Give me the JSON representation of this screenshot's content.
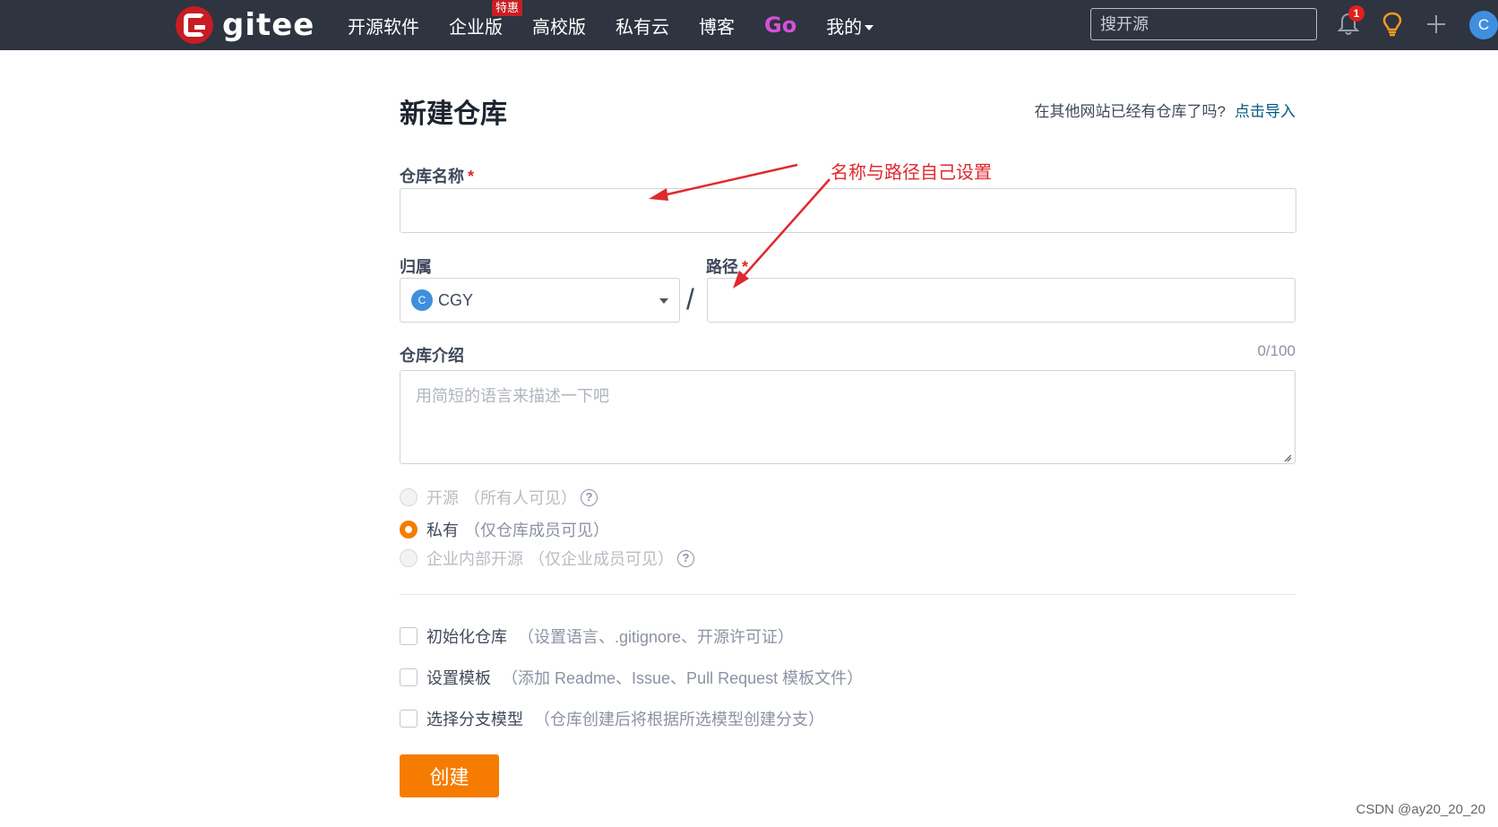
{
  "topbar": {
    "logo_text": "gitee",
    "nav": [
      {
        "label": "开源软件"
      },
      {
        "label": "企业版",
        "badge": "特惠"
      },
      {
        "label": "高校版"
      },
      {
        "label": "私有云"
      },
      {
        "label": "博客"
      },
      {
        "label": "Go"
      },
      {
        "label": "我的"
      }
    ],
    "search_placeholder": "搜开源",
    "notification_count": "1",
    "avatar_letter": "C",
    "icons": [
      "bell-icon",
      "lightbulb-icon",
      "plus-icon"
    ]
  },
  "form": {
    "title": "新建仓库",
    "import_text": "在其他网站已经有仓库了吗?",
    "import_link": "点击导入",
    "name_label": "仓库名称",
    "required_mark": "*",
    "owner_label": "归属",
    "owner_avatar_letter": "C",
    "owner_value": "CGY",
    "slash": "/",
    "path_label": "路径",
    "desc_label": "仓库介绍",
    "desc_counter": "0/100",
    "desc_placeholder": "用简短的语言来描述一下吧",
    "visibility": [
      {
        "main": "开源",
        "sub": "（所有人可见）",
        "selected": false,
        "disabled": true,
        "help": true
      },
      {
        "main": "私有",
        "sub": "（仅仓库成员可见）",
        "selected": true,
        "disabled": false,
        "help": false
      },
      {
        "main": "企业内部开源",
        "sub": "（仅企业成员可见）",
        "selected": false,
        "disabled": true,
        "help": true
      }
    ],
    "help_glyph": "?",
    "options": [
      {
        "main": "初始化仓库",
        "sub": "（设置语言、.gitignore、开源许可证）"
      },
      {
        "main": "设置模板",
        "sub": "（添加 Readme、Issue、Pull Request 模板文件）"
      },
      {
        "main": "选择分支模型",
        "sub": "（仓库创建后将根据所选模型创建分支）"
      }
    ],
    "create_button": "创建"
  },
  "annotation": {
    "text": "名称与路径自己设置",
    "color": "#e0282e"
  },
  "watermark": "CSDN @ay20_20_20",
  "colors": {
    "accent": "#f57c00",
    "topbar": "#2e3440",
    "link": "#005980",
    "brand": "#c71d23"
  }
}
